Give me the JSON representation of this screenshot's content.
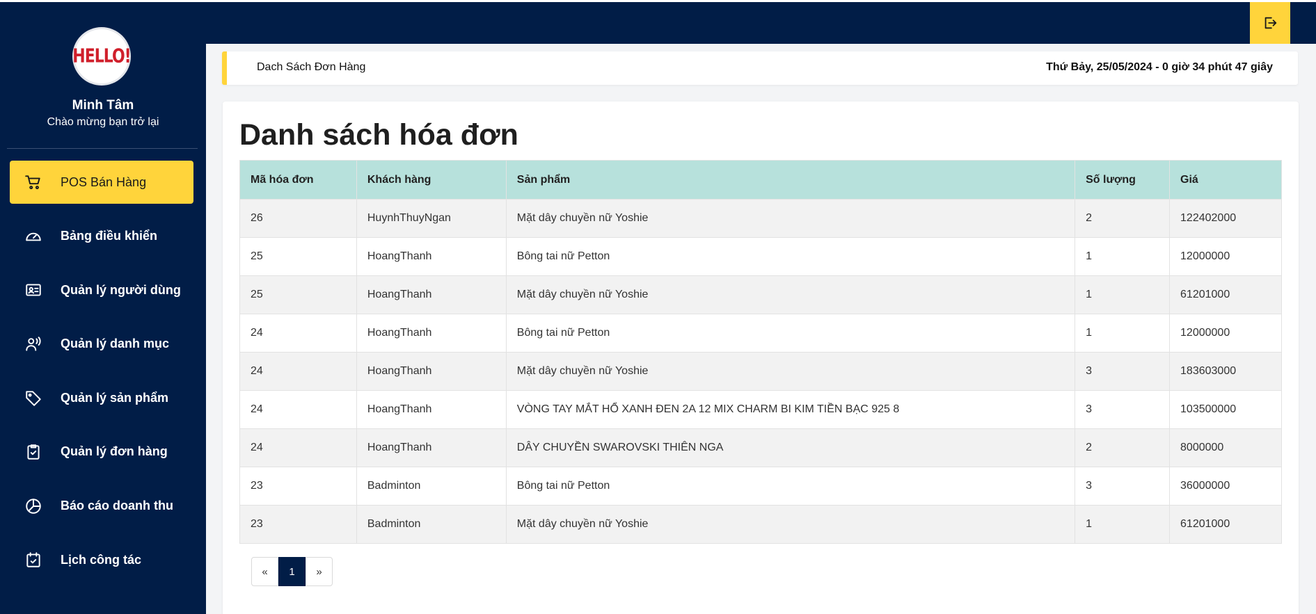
{
  "sidebar": {
    "logo_text": "HELLO!",
    "user_name": "Minh Tâm",
    "welcome": "Chào mừng bạn trở lại",
    "items": [
      {
        "label": "POS Bán Hàng",
        "icon": "cart-icon",
        "active": true
      },
      {
        "label": "Bảng điều khiển",
        "icon": "gauge-icon",
        "active": false
      },
      {
        "label": "Quản lý người dùng",
        "icon": "id-card-icon",
        "active": false
      },
      {
        "label": "Quản lý danh mục",
        "icon": "user-voice-icon",
        "active": false
      },
      {
        "label": "Quản lý sản phẩm",
        "icon": "tag-icon",
        "active": false
      },
      {
        "label": "Quản lý đơn hàng",
        "icon": "clipboard-check-icon",
        "active": false
      },
      {
        "label": "Báo cáo doanh thu",
        "icon": "pie-chart-icon",
        "active": false
      },
      {
        "label": "Lịch công tác",
        "icon": "calendar-check-icon",
        "active": false
      }
    ]
  },
  "topbar": {
    "logout_icon": "logout-icon"
  },
  "header": {
    "title": "Dach Sách Đơn Hàng",
    "datetime": "Thứ Bảy, 25/05/2024 - 0 giờ 34 phút 47 giây"
  },
  "main": {
    "title": "Danh sách hóa đơn",
    "columns": [
      "Mã hóa đơn",
      "Khách hàng",
      "Sản phẩm",
      "Số lượng",
      "Giá"
    ],
    "rows": [
      [
        "26",
        "HuynhThuyNgan",
        "Mặt dây chuyền nữ Yoshie",
        "2",
        "122402000"
      ],
      [
        "25",
        "HoangThanh",
        "Bông tai nữ Petton",
        "1",
        "12000000"
      ],
      [
        "25",
        "HoangThanh",
        "Mặt dây chuyền nữ Yoshie",
        "1",
        "61201000"
      ],
      [
        "24",
        "HoangThanh",
        "Bông tai nữ Petton",
        "1",
        "12000000"
      ],
      [
        "24",
        "HoangThanh",
        "Mặt dây chuyền nữ Yoshie",
        "3",
        "183603000"
      ],
      [
        "24",
        "HoangThanh",
        "VÒNG TAY MẮT HỔ XANH ĐEN 2A 12 MIX CHARM BI KIM TIỀN BẠC 925 8",
        "3",
        "103500000"
      ],
      [
        "24",
        "HoangThanh",
        "DÂY CHUYỀN SWAROVSKI THIÊN NGA",
        "2",
        "8000000"
      ],
      [
        "23",
        "Badminton",
        "Bông tai nữ Petton",
        "3",
        "36000000"
      ],
      [
        "23",
        "Badminton",
        "Mặt dây chuyền nữ Yoshie",
        "1",
        "61201000"
      ]
    ]
  },
  "pagination": {
    "prev": "«",
    "current": "1",
    "next": "»"
  },
  "colors": {
    "navy": "#011d47",
    "accent": "#ffd43b",
    "table_header": "#b7e1dc"
  }
}
